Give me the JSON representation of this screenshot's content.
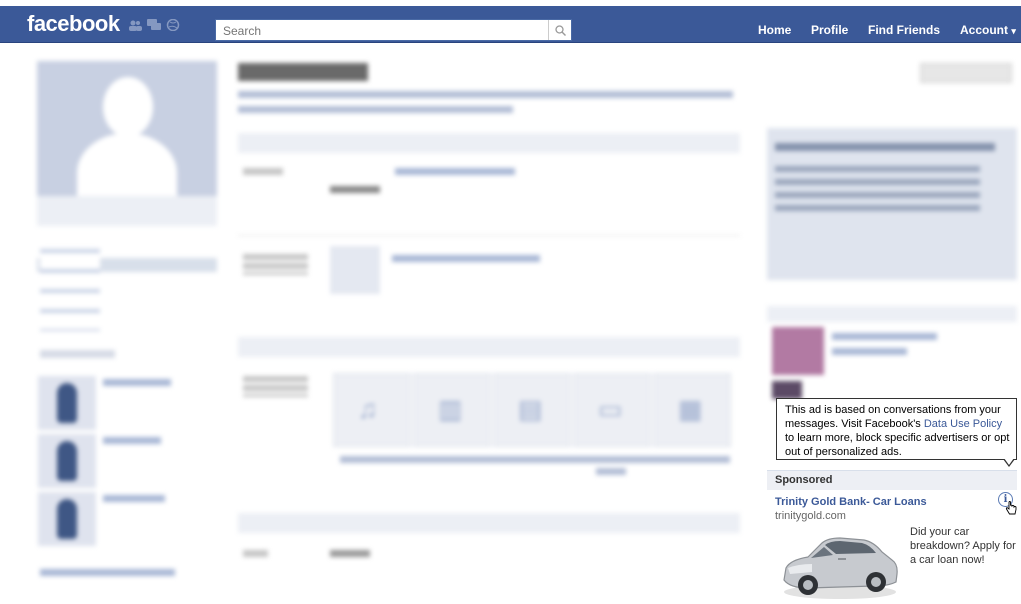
{
  "header": {
    "logo": "facebook",
    "search_placeholder": "Search",
    "nav": {
      "home": "Home",
      "profile": "Profile",
      "find_friends": "Find Friends",
      "account": "Account"
    }
  },
  "tooltip": {
    "text_before_link": "This ad is based on conversations from your messages. Visit Facebook's ",
    "link": "Data Use Policy",
    "text_after_link": " to learn more, block specific advertisers or opt out of personalized ads."
  },
  "sponsored": {
    "heading": "Sponsored",
    "ad": {
      "title": "Trinity Gold Bank- Car Loans",
      "domain": "trinitygold.com",
      "body": "Did your car breakdown? Apply for a car loan now!",
      "image": "car-photo",
      "info_icon": "info-icon"
    }
  },
  "colors": {
    "header_blue": "#3b5998",
    "link_blue": "#3b5998",
    "section_bar": "#eceff5",
    "tooltip_border": "#333333"
  }
}
